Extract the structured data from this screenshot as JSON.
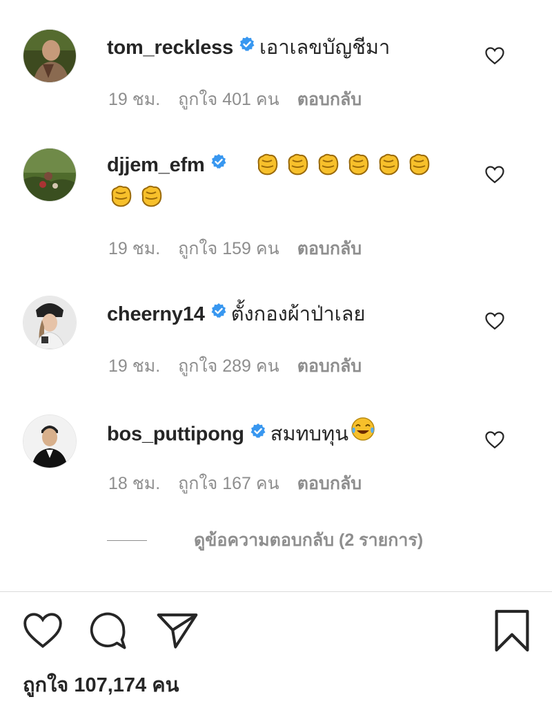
{
  "comments": [
    {
      "username": "tom_reckless",
      "text": "เอาเลขบัญชีมา",
      "time": "19 ชม.",
      "likes": "ถูกใจ 401 คน",
      "reply": "ตอบกลับ",
      "emoji_line1": [],
      "emoji_line2": []
    },
    {
      "username": "djjem_efm",
      "text": "",
      "time": "19 ชม.",
      "likes": "ถูกใจ 159 คน",
      "reply": "ตอบกลับ",
      "emoji_line1": [
        "clapping-hands",
        "clapping-hands",
        "clapping-hands",
        "clapping-hands",
        "clapping-hands",
        "clapping-hands"
      ],
      "emoji_line2": [
        "clapping-hands",
        "clapping-hands"
      ]
    },
    {
      "username": "cheerny14",
      "text": "ตั้งกองผ้าป่าเลย",
      "time": "19 ชม.",
      "likes": "ถูกใจ 289 คน",
      "reply": "ตอบกลับ",
      "emoji_line1": [],
      "emoji_line2": []
    },
    {
      "username": "bos_puttipong",
      "text": "สมทบทุน",
      "time": "18 ชม.",
      "likes": "ถูกใจ 167 คน",
      "reply": "ตอบกลับ",
      "emoji_line1": [
        "tears-of-joy"
      ],
      "emoji_line2": []
    }
  ],
  "view_replies": "ดูข้อความตอบกลับ (2 รายการ)",
  "post_likes": "ถูกใจ 107,174 คน",
  "icons": {
    "verified": "verified-badge-icon",
    "like": "heart-icon",
    "comment": "comment-bubble-icon",
    "share": "paper-plane-icon",
    "save": "bookmark-icon"
  },
  "colors": {
    "verified": "#3897f0",
    "text": "#262626",
    "muted": "#8e8e8e",
    "divider": "#dbdbdb"
  }
}
